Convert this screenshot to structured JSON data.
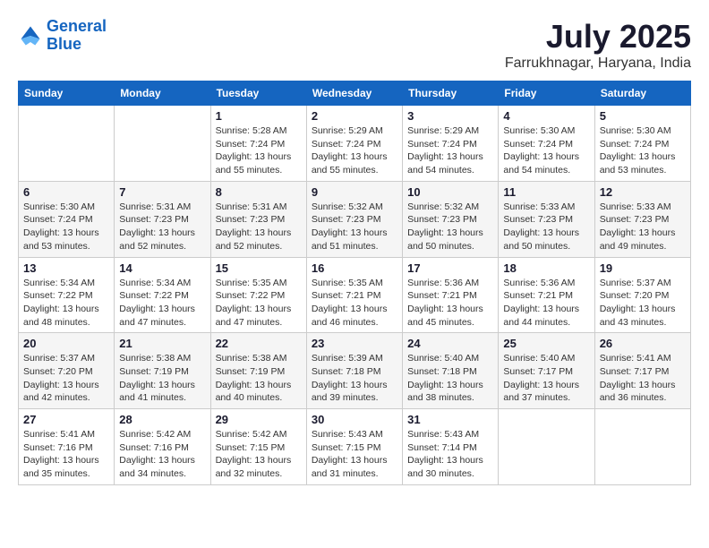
{
  "logo": {
    "line1": "General",
    "line2": "Blue"
  },
  "title": "July 2025",
  "location": "Farrukhnagar, Haryana, India",
  "weekdays": [
    "Sunday",
    "Monday",
    "Tuesday",
    "Wednesday",
    "Thursday",
    "Friday",
    "Saturday"
  ],
  "rows": [
    [
      {
        "day": "",
        "info": ""
      },
      {
        "day": "",
        "info": ""
      },
      {
        "day": "1",
        "info": "Sunrise: 5:28 AM\nSunset: 7:24 PM\nDaylight: 13 hours and 55 minutes."
      },
      {
        "day": "2",
        "info": "Sunrise: 5:29 AM\nSunset: 7:24 PM\nDaylight: 13 hours and 55 minutes."
      },
      {
        "day": "3",
        "info": "Sunrise: 5:29 AM\nSunset: 7:24 PM\nDaylight: 13 hours and 54 minutes."
      },
      {
        "day": "4",
        "info": "Sunrise: 5:30 AM\nSunset: 7:24 PM\nDaylight: 13 hours and 54 minutes."
      },
      {
        "day": "5",
        "info": "Sunrise: 5:30 AM\nSunset: 7:24 PM\nDaylight: 13 hours and 53 minutes."
      }
    ],
    [
      {
        "day": "6",
        "info": "Sunrise: 5:30 AM\nSunset: 7:24 PM\nDaylight: 13 hours and 53 minutes."
      },
      {
        "day": "7",
        "info": "Sunrise: 5:31 AM\nSunset: 7:23 PM\nDaylight: 13 hours and 52 minutes."
      },
      {
        "day": "8",
        "info": "Sunrise: 5:31 AM\nSunset: 7:23 PM\nDaylight: 13 hours and 52 minutes."
      },
      {
        "day": "9",
        "info": "Sunrise: 5:32 AM\nSunset: 7:23 PM\nDaylight: 13 hours and 51 minutes."
      },
      {
        "day": "10",
        "info": "Sunrise: 5:32 AM\nSunset: 7:23 PM\nDaylight: 13 hours and 50 minutes."
      },
      {
        "day": "11",
        "info": "Sunrise: 5:33 AM\nSunset: 7:23 PM\nDaylight: 13 hours and 50 minutes."
      },
      {
        "day": "12",
        "info": "Sunrise: 5:33 AM\nSunset: 7:23 PM\nDaylight: 13 hours and 49 minutes."
      }
    ],
    [
      {
        "day": "13",
        "info": "Sunrise: 5:34 AM\nSunset: 7:22 PM\nDaylight: 13 hours and 48 minutes."
      },
      {
        "day": "14",
        "info": "Sunrise: 5:34 AM\nSunset: 7:22 PM\nDaylight: 13 hours and 47 minutes."
      },
      {
        "day": "15",
        "info": "Sunrise: 5:35 AM\nSunset: 7:22 PM\nDaylight: 13 hours and 47 minutes."
      },
      {
        "day": "16",
        "info": "Sunrise: 5:35 AM\nSunset: 7:21 PM\nDaylight: 13 hours and 46 minutes."
      },
      {
        "day": "17",
        "info": "Sunrise: 5:36 AM\nSunset: 7:21 PM\nDaylight: 13 hours and 45 minutes."
      },
      {
        "day": "18",
        "info": "Sunrise: 5:36 AM\nSunset: 7:21 PM\nDaylight: 13 hours and 44 minutes."
      },
      {
        "day": "19",
        "info": "Sunrise: 5:37 AM\nSunset: 7:20 PM\nDaylight: 13 hours and 43 minutes."
      }
    ],
    [
      {
        "day": "20",
        "info": "Sunrise: 5:37 AM\nSunset: 7:20 PM\nDaylight: 13 hours and 42 minutes."
      },
      {
        "day": "21",
        "info": "Sunrise: 5:38 AM\nSunset: 7:19 PM\nDaylight: 13 hours and 41 minutes."
      },
      {
        "day": "22",
        "info": "Sunrise: 5:38 AM\nSunset: 7:19 PM\nDaylight: 13 hours and 40 minutes."
      },
      {
        "day": "23",
        "info": "Sunrise: 5:39 AM\nSunset: 7:18 PM\nDaylight: 13 hours and 39 minutes."
      },
      {
        "day": "24",
        "info": "Sunrise: 5:40 AM\nSunset: 7:18 PM\nDaylight: 13 hours and 38 minutes."
      },
      {
        "day": "25",
        "info": "Sunrise: 5:40 AM\nSunset: 7:17 PM\nDaylight: 13 hours and 37 minutes."
      },
      {
        "day": "26",
        "info": "Sunrise: 5:41 AM\nSunset: 7:17 PM\nDaylight: 13 hours and 36 minutes."
      }
    ],
    [
      {
        "day": "27",
        "info": "Sunrise: 5:41 AM\nSunset: 7:16 PM\nDaylight: 13 hours and 35 minutes."
      },
      {
        "day": "28",
        "info": "Sunrise: 5:42 AM\nSunset: 7:16 PM\nDaylight: 13 hours and 34 minutes."
      },
      {
        "day": "29",
        "info": "Sunrise: 5:42 AM\nSunset: 7:15 PM\nDaylight: 13 hours and 32 minutes."
      },
      {
        "day": "30",
        "info": "Sunrise: 5:43 AM\nSunset: 7:15 PM\nDaylight: 13 hours and 31 minutes."
      },
      {
        "day": "31",
        "info": "Sunrise: 5:43 AM\nSunset: 7:14 PM\nDaylight: 13 hours and 30 minutes."
      },
      {
        "day": "",
        "info": ""
      },
      {
        "day": "",
        "info": ""
      }
    ]
  ]
}
